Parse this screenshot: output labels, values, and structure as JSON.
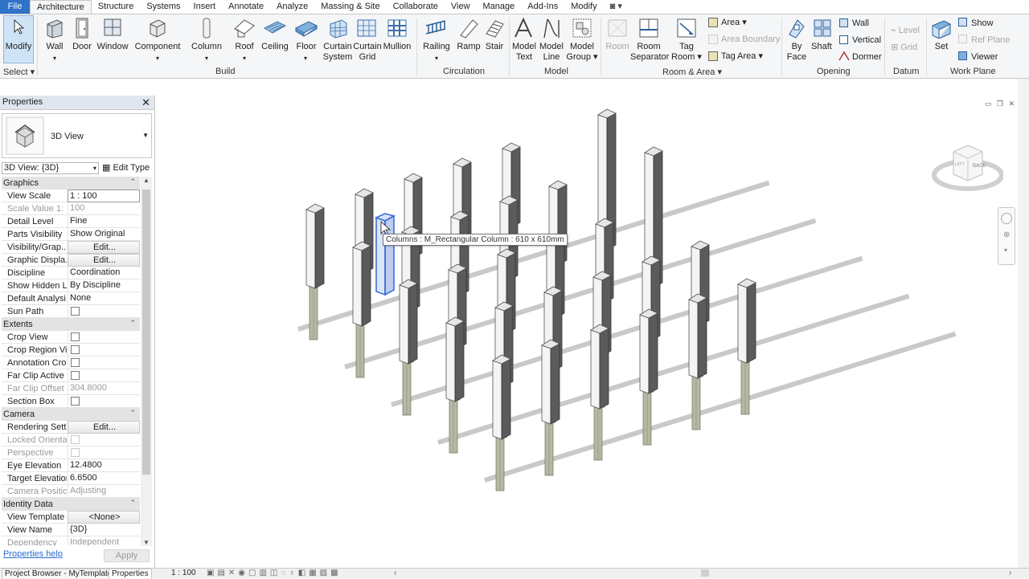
{
  "ribbon": {
    "tabs": [
      "File",
      "Architecture",
      "Structure",
      "Systems",
      "Insert",
      "Annotate",
      "Analyze",
      "Massing & Site",
      "Collaborate",
      "View",
      "Manage",
      "Add-Ins",
      "Modify"
    ],
    "active_tab": "Architecture",
    "tools": {
      "modify": "Modify",
      "wall": "Wall",
      "door": "Door",
      "window": "Window",
      "component": "Component",
      "column": "Column",
      "roof": "Roof",
      "ceiling": "Ceiling",
      "floor": "Floor",
      "curtain_system_1": "Curtain",
      "curtain_system_2": "System",
      "curtain_grid_1": "Curtain",
      "curtain_grid_2": "Grid",
      "mullion": "Mullion",
      "railing": "Railing",
      "ramp": "Ramp",
      "stair": "Stair",
      "model_text_1": "Model",
      "model_text_2": "Text",
      "model_line_1": "Model",
      "model_line_2": "Line",
      "model_group_1": "Model",
      "model_group_2": "Group",
      "room": "Room",
      "room_sep_1": "Room",
      "room_sep_2": "Separator",
      "tag_room_1": "Tag",
      "tag_room_2": "Room",
      "area": "Area",
      "area_boundary": "Area  Boundary",
      "tag_area": "Tag  Area",
      "by_face_1": "By",
      "by_face_2": "Face",
      "shaft": "Shaft",
      "wall_opening": "Wall",
      "vertical": "Vertical",
      "dormer": "Dormer",
      "level": "Level",
      "grid": "Grid",
      "set": "Set",
      "show": "Show",
      "ref_plane": "Ref  Plane",
      "viewer": "Viewer"
    },
    "panels": {
      "select": "Select",
      "build": "Build",
      "circulation": "Circulation",
      "model": "Model",
      "room_area": "Room & Area",
      "opening": "Opening",
      "datum": "Datum",
      "work_plane": "Work Plane"
    }
  },
  "properties": {
    "title": "Properties",
    "type_name": "3D View",
    "view_selector": "3D View: {3D}",
    "edit_type": "Edit Type",
    "rows": [
      {
        "type": "group",
        "label": "Graphics"
      },
      {
        "label": "View Scale",
        "value": "1 : 100",
        "style": "box"
      },
      {
        "label": "Scale Value    1:",
        "value": "100",
        "dis": true
      },
      {
        "label": "Detail Level",
        "value": "Fine"
      },
      {
        "label": "Parts Visibility",
        "value": "Show Original"
      },
      {
        "label": "Visibility/Grap...",
        "value": "Edit...",
        "style": "btn"
      },
      {
        "label": "Graphic Displa...",
        "value": "Edit...",
        "style": "btn"
      },
      {
        "label": "Discipline",
        "value": "Coordination"
      },
      {
        "label": "Show Hidden L...",
        "value": "By Discipline"
      },
      {
        "label": "Default Analysi...",
        "value": "None"
      },
      {
        "label": "Sun Path",
        "check": true
      },
      {
        "type": "group",
        "label": "Extents"
      },
      {
        "label": "Crop View",
        "check": true
      },
      {
        "label": "Crop Region Vi...",
        "check": true
      },
      {
        "label": "Annotation Crop",
        "check": true
      },
      {
        "label": "Far Clip Active",
        "check": true
      },
      {
        "label": "Far Clip Offset",
        "value": "304.8000",
        "dis": true
      },
      {
        "label": "Section Box",
        "check": true
      },
      {
        "type": "group",
        "label": "Camera"
      },
      {
        "label": "Rendering Sett...",
        "value": "Edit...",
        "style": "btn"
      },
      {
        "label": "Locked Orienta...",
        "check": true,
        "dis": true
      },
      {
        "label": "Perspective",
        "check": true,
        "dis": true
      },
      {
        "label": "Eye Elevation",
        "value": "12.4800"
      },
      {
        "label": "Target Elevation",
        "value": "6.6500"
      },
      {
        "label": "Camera Position",
        "value": "Adjusting",
        "dis": true
      },
      {
        "type": "group",
        "label": "Identity Data"
      },
      {
        "label": "View Template",
        "value": "<None>",
        "style": "btn"
      },
      {
        "label": "View Name",
        "value": "{3D}"
      },
      {
        "label": "Dependency",
        "value": "Independent",
        "dis": true
      }
    ],
    "help": "Properties help",
    "apply": "Apply"
  },
  "viewport": {
    "tooltip": "Columns : M_Rectangular Column : 610 x 610mm",
    "viewcube_labels": [
      "BACK",
      "LEFT"
    ]
  },
  "status": {
    "browser_tab": "Project Browser - MyTemplate...",
    "properties_tab": "Properties",
    "scale": "1 : 100"
  },
  "colors": {
    "file_tab": "#2e73c8",
    "selection": "#3f6fd6",
    "column_light": "#f4f4f4",
    "column_dark": "#5b5b5b",
    "beam_shadow": "#c9c9c9",
    "concrete_post": "#b5b9a4"
  }
}
